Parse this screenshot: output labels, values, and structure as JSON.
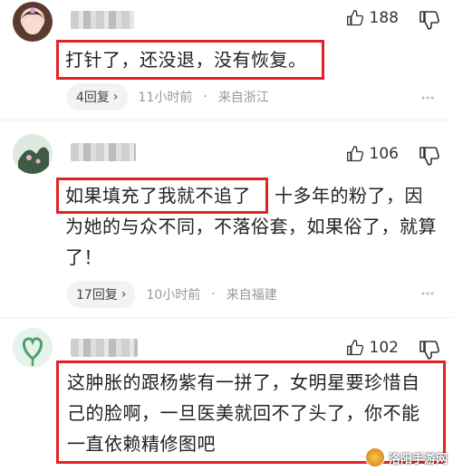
{
  "comments": [
    {
      "like_count": "188",
      "text_highlighted": "打针了，还没退，没有恢复。",
      "text_rest": "",
      "reply_label": "4回复",
      "time": "11小时前",
      "location": "来自浙江"
    },
    {
      "like_count": "106",
      "text_highlighted": "如果填充了我就不追了",
      "text_rest": "十多年的粉了，因为她的与众不同，不落俗套，如果俗了，就算了！",
      "reply_label": "17回复",
      "time": "10小时前",
      "location": "来自福建"
    },
    {
      "like_count": "102",
      "text_highlighted": "这肿胀的跟杨紫有一拼了，女明星要珍惜自己的脸啊，一旦医美就回不了头了，你不能一直依赖精修图吧",
      "text_rest": ""
    }
  ],
  "watermark": {
    "text": "洛阳手游网"
  },
  "colors": {
    "highlight": "#e02424",
    "meta": "#999999"
  }
}
